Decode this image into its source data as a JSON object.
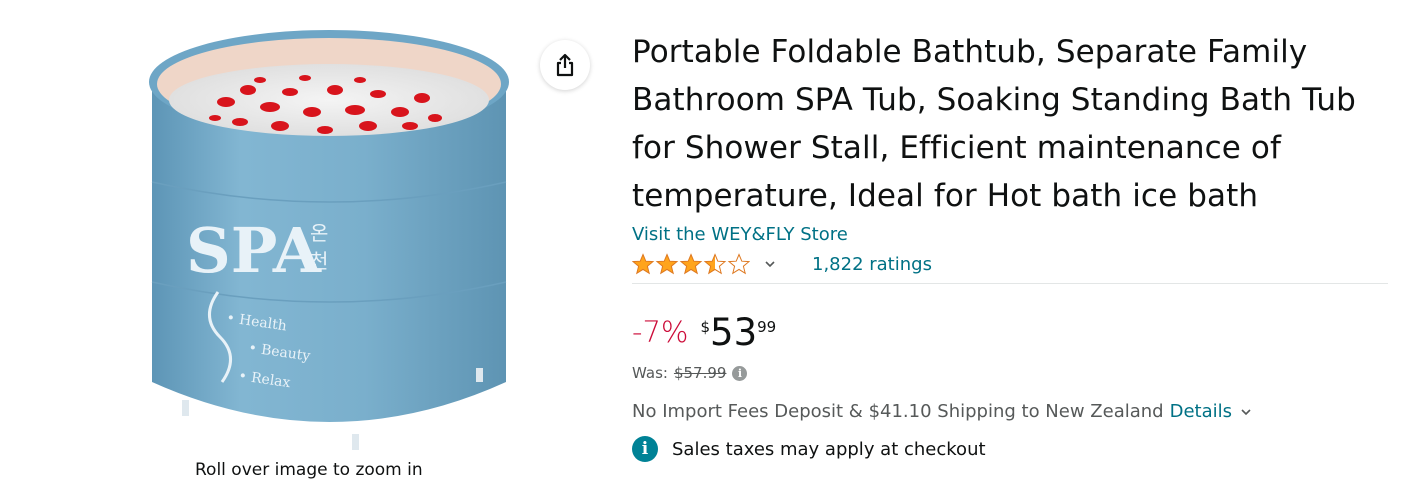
{
  "product": {
    "title": "Portable Foldable Bathtub, Separate Family Bathroom SPA Tub, Soaking Standing Bath Tub for Shower Stall, Efficient maintenance of temperature, Ideal for Hot bath ice bath",
    "store_link": "Visit the WEY&FLY Store",
    "rating": 3.5,
    "ratings_count": "1,822 ratings",
    "discount": "-7%",
    "price_symbol": "$",
    "price_whole": "53",
    "price_fraction": "99",
    "was_label": "Was:",
    "was_price": "$57.99",
    "shipping_text": "No Import Fees Deposit & $41.10 Shipping to New Zealand",
    "details_link": "Details",
    "tax_text": "Sales taxes may apply at checkout"
  },
  "image": {
    "brand_text": "SPA",
    "korean_text": [
      "온",
      "천"
    ],
    "features": [
      "Health",
      "Beauty",
      "Relax"
    ],
    "caption": "Roll over image to zoom in"
  },
  "colors": {
    "link": "#007185",
    "discount": "#CC0C39",
    "star": "#FFA41C",
    "info_badge": "#008296",
    "tub_blue": "#7AB0CE"
  },
  "icons": {
    "share": "share-icon",
    "chevron": "chevron-down-icon",
    "info": "info-icon"
  }
}
